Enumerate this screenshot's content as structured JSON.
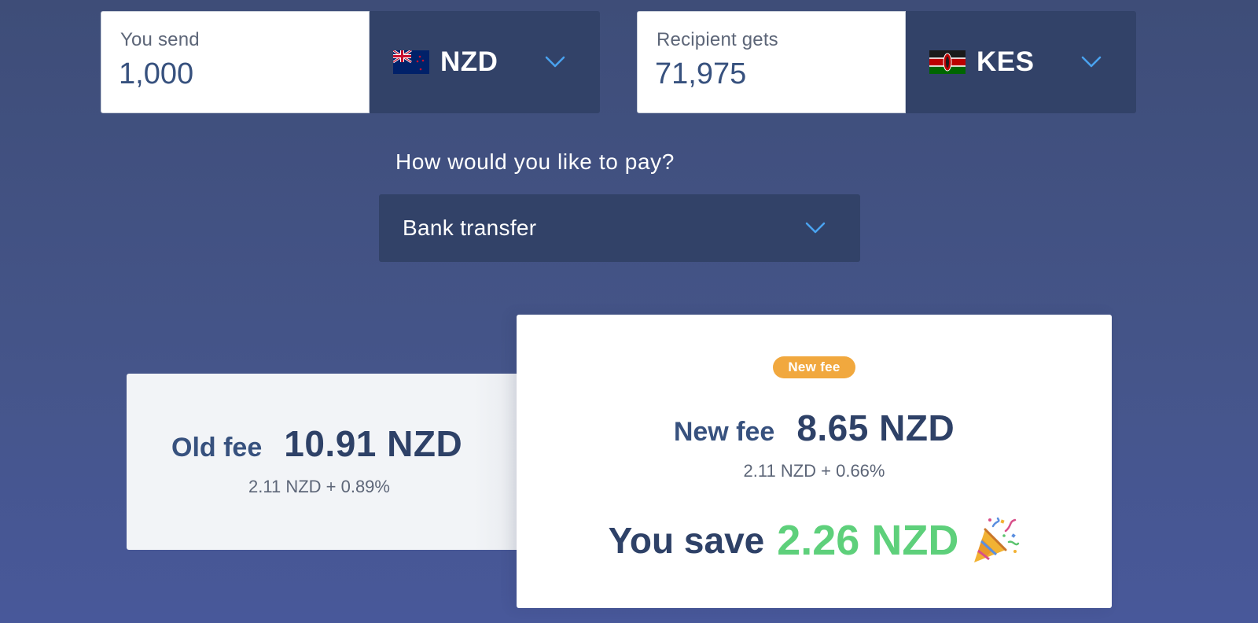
{
  "colors": {
    "background": "#44548a",
    "panel_dark": "#324268",
    "accent_blue": "#4aa3f0",
    "text_navy": "#2e4167",
    "savings_green": "#5ed07b",
    "badge_orange": "#f1a83e"
  },
  "send": {
    "label": "You send",
    "amount": "1,000",
    "currency": "NZD",
    "flag_icon": "new-zealand-flag-icon"
  },
  "receive": {
    "label": "Recipient gets",
    "amount": "71,975",
    "currency": "KES",
    "flag_icon": "kenya-flag-icon"
  },
  "payment": {
    "question": "How would you like to pay?",
    "selected": "Bank transfer"
  },
  "old_fee": {
    "label": "Old fee",
    "amount": "10.91 NZD",
    "breakdown": "2.11 NZD + 0.89%"
  },
  "new_fee": {
    "badge": "New fee",
    "label": "New fee",
    "amount": "8.65 NZD",
    "breakdown": "2.11 NZD + 0.66%"
  },
  "savings": {
    "label": "You save",
    "amount": "2.26 NZD",
    "icon": "party-popper-icon"
  }
}
